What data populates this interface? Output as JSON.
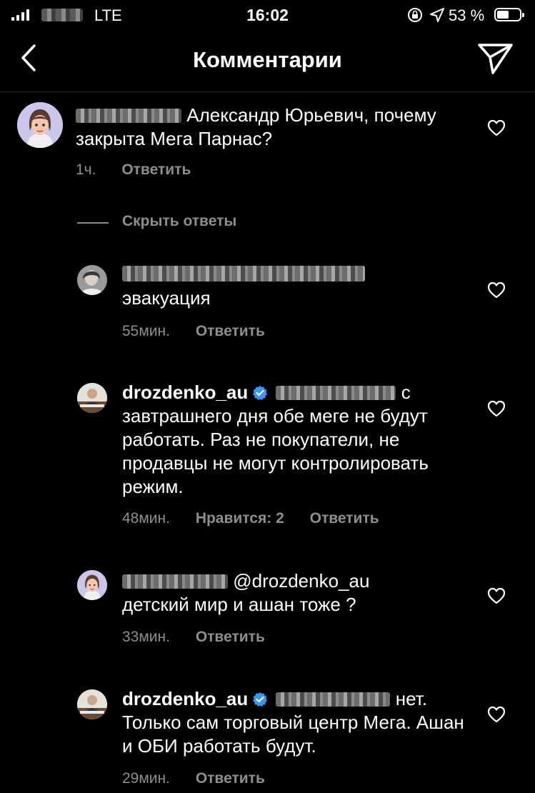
{
  "status": {
    "carrier_type": "LTE",
    "time": "16:02",
    "battery": "53 %"
  },
  "nav": {
    "title": "Комментарии",
    "back_icon": "chevron-left-icon",
    "share_icon": "paper-plane-icon"
  },
  "comments": [
    {
      "text": "Александр Юрьевич, почему закрыта Мега Парнас?",
      "time": "1ч.",
      "reply": "Ответить"
    },
    {
      "hide_replies": "Скрыть ответы"
    },
    {
      "text": "эвакуация",
      "time": "55мин.",
      "reply": "Ответить"
    },
    {
      "user": "drozdenko_au",
      "text_suffix": "с",
      "text": "завтрашнего дня обе меге не будут работать. Раз не покупатели, не продавцы не могут контролировать режим.",
      "time": "48мин.",
      "likes": "Нравится: 2",
      "reply": "Ответить"
    },
    {
      "mention": "@drozdenko_au",
      "text": "детский мир и ашан тоже ?",
      "time": "33мин.",
      "reply": "Ответить"
    },
    {
      "user": "drozdenko_au",
      "text_suffix": "нет.",
      "text": "Только сам торговый центр Мега. Ашан и ОБИ работать будут.",
      "time": "29мин.",
      "reply": "Ответить"
    }
  ],
  "colors": {
    "background": "#000000",
    "secondary_text": "#8e8e8e",
    "verified": "#3897f0"
  }
}
